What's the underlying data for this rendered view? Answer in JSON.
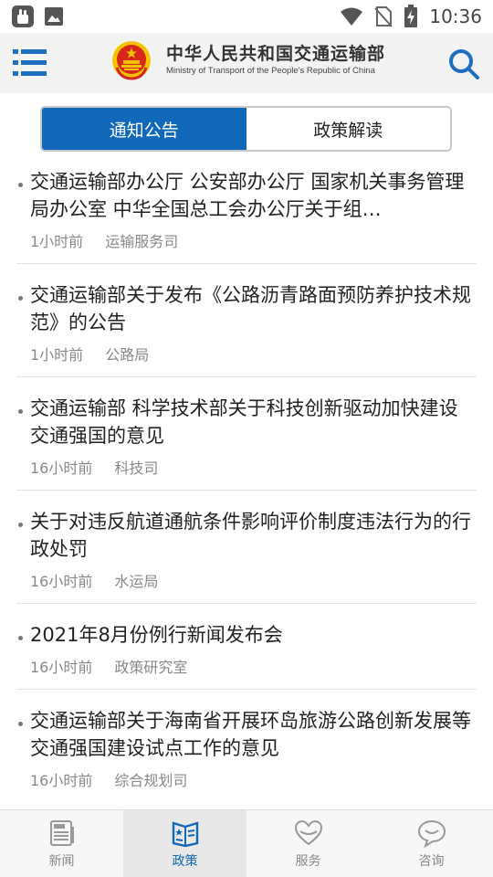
{
  "status_bar": {
    "time": "10:36"
  },
  "header": {
    "title_cn": "中华人民共和国交通运输部",
    "title_en": "Ministry of Transport of the People's Republic of China"
  },
  "tabs": [
    {
      "label": "通知公告",
      "active": true
    },
    {
      "label": "政策解读",
      "active": false
    }
  ],
  "articles": [
    {
      "title": "交通运输部办公厅 公安部办公厅 国家机关事务管理局办公室 中华全国总工会办公厅关于组…",
      "time": "1小时前",
      "source": "运输服务司"
    },
    {
      "title": "交通运输部关于发布《公路沥青路面预防养护技术规范》的公告",
      "time": "1小时前",
      "source": "公路局"
    },
    {
      "title": "交通运输部 科学技术部关于科技创新驱动加快建设交通强国的意见",
      "time": "16小时前",
      "source": "科技司"
    },
    {
      "title": "关于对违反航道通航条件影响评价制度违法行为的行政处罚",
      "time": "16小时前",
      "source": "水运局"
    },
    {
      "title": "2021年8月份例行新闻发布会",
      "time": "16小时前",
      "source": "政策研究室"
    },
    {
      "title": "交通运输部关于海南省开展环岛旅游公路创新发展等交通强国建设试点工作的意见",
      "time": "16小时前",
      "source": "综合规划司"
    }
  ],
  "bottom_nav": [
    {
      "label": "新闻",
      "icon": "newspaper-icon",
      "active": false
    },
    {
      "label": "政策",
      "icon": "policy-book-icon",
      "active": true
    },
    {
      "label": "服务",
      "icon": "heart-icon",
      "active": false
    },
    {
      "label": "咨询",
      "icon": "chat-bubble-icon",
      "active": false
    }
  ],
  "colors": {
    "accent": "#1268b8",
    "header_bg": "#f3f3f3",
    "emblem_red": "#d9261c",
    "emblem_gold": "#f3c300"
  }
}
